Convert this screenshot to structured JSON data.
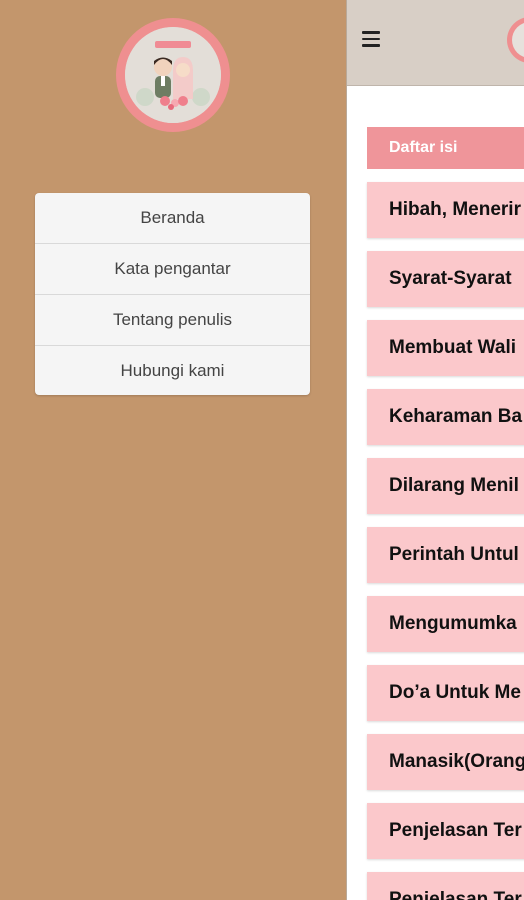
{
  "drawer": {
    "menu": [
      {
        "label": "Beranda"
      },
      {
        "label": "Kata pengantar"
      },
      {
        "label": "Tentang penulis"
      },
      {
        "label": "Hubungi kami"
      }
    ]
  },
  "toc": {
    "header": "Daftar isi",
    "items": [
      {
        "label": "Hibah, Menerir"
      },
      {
        "label": "Syarat-Syarat"
      },
      {
        "label": "Membuat Wali"
      },
      {
        "label": "Keharaman Ba"
      },
      {
        "label": "Dilarang Menil"
      },
      {
        "label": "Perintah Untul"
      },
      {
        "label": "Mengumumka"
      },
      {
        "label": "Do’a Untuk Me"
      },
      {
        "label": "Manasik(Orang"
      },
      {
        "label": "Penjelasan Ter"
      },
      {
        "label": "Penjelasan Ter"
      }
    ]
  },
  "colors": {
    "drawer_bg": "#c3966c",
    "avatar_ring": "#ef8f90",
    "toc_header_bg": "#ef959a",
    "toc_item_bg": "#fbc8cb",
    "topbar_bg": "#d8cfc6"
  },
  "icons": {
    "menu": "hamburger-icon",
    "avatar": "couple-illustration"
  }
}
